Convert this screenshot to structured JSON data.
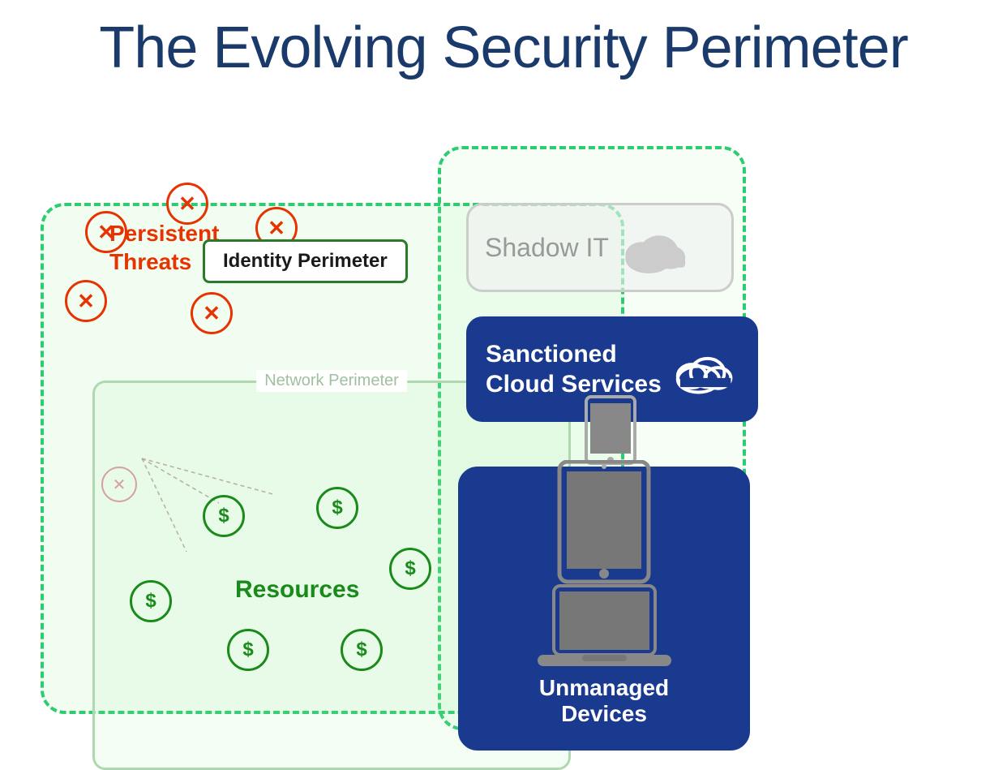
{
  "title": "The Evolving Security Perimeter",
  "labels": {
    "identity_perimeter": "Identity Perimeter",
    "network_perimeter": "Network Perimeter",
    "shadow_it": "Shadow IT",
    "sanctioned_cloud": "Sanctioned\nCloud Services",
    "sanctioned_cloud_line1": "Sanctioned",
    "sanctioned_cloud_line2": "Cloud Services",
    "unmanaged_devices_line1": "Unmanaged",
    "unmanaged_devices_line2": "Devices",
    "persistent_threats_line1": "Persistent",
    "persistent_threats_line2": "Threats",
    "resources": "Resources"
  },
  "colors": {
    "title": "#1a3a6b",
    "threat_red": "#e63300",
    "green_border": "#2ecc71",
    "dark_green": "#2a7a2a",
    "resource_green": "#1a8a1a",
    "navy": "#1a3a8f",
    "shadow_gray": "#999999",
    "faded_threat": "#d4a0a0"
  }
}
